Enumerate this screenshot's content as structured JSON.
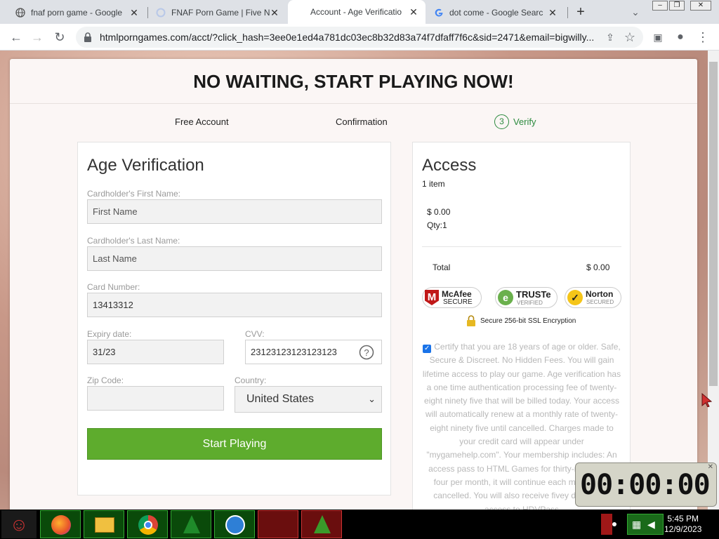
{
  "tabs": [
    {
      "title": "fnaf porn game - Google",
      "icon": "globe-icon"
    },
    {
      "title": "FNAF Porn Game | Five N",
      "icon": "loading-icon"
    },
    {
      "title": "Account - Age Verificatio",
      "icon": "none"
    },
    {
      "title": "dot come - Google Searc",
      "icon": "google-icon"
    }
  ],
  "new_tab_label": "+",
  "url": "htmlporngames.com/acct/?click_hash=3ee0e1ed4a781dc03ec8b32d83a74f7dfaff7f6c&sid=2471&email=bigwilly...",
  "headline": "NO WAITING, START PLAYING NOW!",
  "steps": {
    "s1": "Free Account",
    "s2": "Confirmation",
    "s3_num": "3",
    "s3": "Verify"
  },
  "form": {
    "title": "Age Verification",
    "first_name_label": "Cardholder's First Name:",
    "first_name_placeholder": "First Name",
    "last_name_label": "Cardholder's Last Name:",
    "last_name_placeholder": "Last Name",
    "card_label": "Card Number:",
    "card_value": "13413312",
    "expiry_label": "Expiry date:",
    "expiry_value": "31/23",
    "cvv_label": "CVV:",
    "cvv_value": "23123123123123123",
    "zip_label": "Zip Code:",
    "zip_value": "",
    "country_label": "Country:",
    "country_value": "United States",
    "start_button": "Start Playing"
  },
  "access": {
    "title": "Access",
    "items": "1 item",
    "price": "$ 0.00",
    "qty": "Qty:1",
    "total_label": "Total",
    "total_value": "$ 0.00",
    "badges": {
      "mcafee": "McAfee",
      "mcafee_sub": "SECURE",
      "truste": "TRUSTe",
      "truste_sub": "VERIFIED",
      "norton": "Norton",
      "norton_sub": "SECURED"
    },
    "ssl": "Secure 256-bit SSL Encryption",
    "terms": "Certify that you are 18 years of age or older. Safe, Secure & Discreet. No Hidden Fees. You will gain lifetime access to play our game. Age verification has a one time authentication processing fee of twenty-eight ninety five that will be billed today. Your access will automatically renew at a monthly rate of twenty-eight ninety five until cancelled. Charges made to your credit card will appear under \"mygamehelp.com\". Your membership includes: An access pass to HTML Games for thirty-nine ninety four per month, it will continue each month until cancelled. You will also receive fivey day bonus access to HDVPass"
  },
  "timer": "00:00:00",
  "clock": {
    "time": "5:45 PM",
    "date": "12/9/2023"
  },
  "colors": {
    "accent_green": "#5eac2d",
    "step_green": "#2c8a3e",
    "page_bg": "#fbf6f5"
  }
}
